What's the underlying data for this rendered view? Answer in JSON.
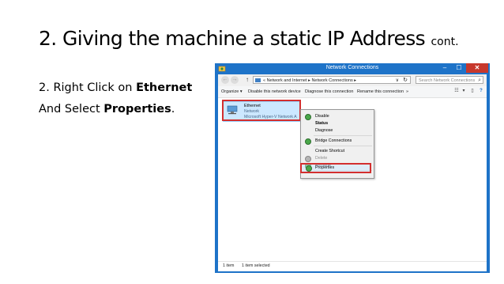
{
  "slide": {
    "title_main": "2. Giving the machine a static IP Address",
    "title_cont": "cont.",
    "line1_pre": "2. Right Click on ",
    "line1_bold": "Ethernet",
    "line2_pre": "And Select ",
    "line2_bold": "Properties",
    "line2_post": "."
  },
  "window": {
    "title": "Network Connections",
    "min_glyph": "–",
    "max_glyph": "☐",
    "close_glyph": "✕",
    "back_glyph": "←",
    "fwd_glyph": "→",
    "up_glyph": "↑",
    "address": "«  Network and Internet  ▸  Network Connections  ▸",
    "address_dropdown": "∨",
    "refresh_glyph": "↻",
    "search_placeholder": "Search Network Connections",
    "search_glyph": "⌕"
  },
  "toolbar": {
    "organize": "Organize ▾",
    "disable": "Disable this network device",
    "diagnose": "Diagnose this connection",
    "rename": "Rename this connection",
    "more": "»",
    "view_glyph": "☷",
    "view_dd": "▾",
    "pane_glyph": "▯",
    "help_glyph": "?"
  },
  "adapter": {
    "name": "Ethernet",
    "status": "Network",
    "device": "Microsoft Hyper-V Network A"
  },
  "context_menu": {
    "items": [
      {
        "label": "Disable"
      },
      {
        "label": "Status"
      },
      {
        "label": "Diagnose"
      },
      {
        "label": "Bridge Connections"
      },
      {
        "label": "Create Shortcut"
      },
      {
        "label": "Delete"
      },
      {
        "label": "Rename"
      },
      {
        "label": "Properties"
      }
    ]
  },
  "statusbar": {
    "count": "1 item",
    "selected": "1 item selected"
  },
  "colors": {
    "highlight": "#d32f2f",
    "window_frame": "#1e73c8",
    "selection": "#cce8ff"
  }
}
